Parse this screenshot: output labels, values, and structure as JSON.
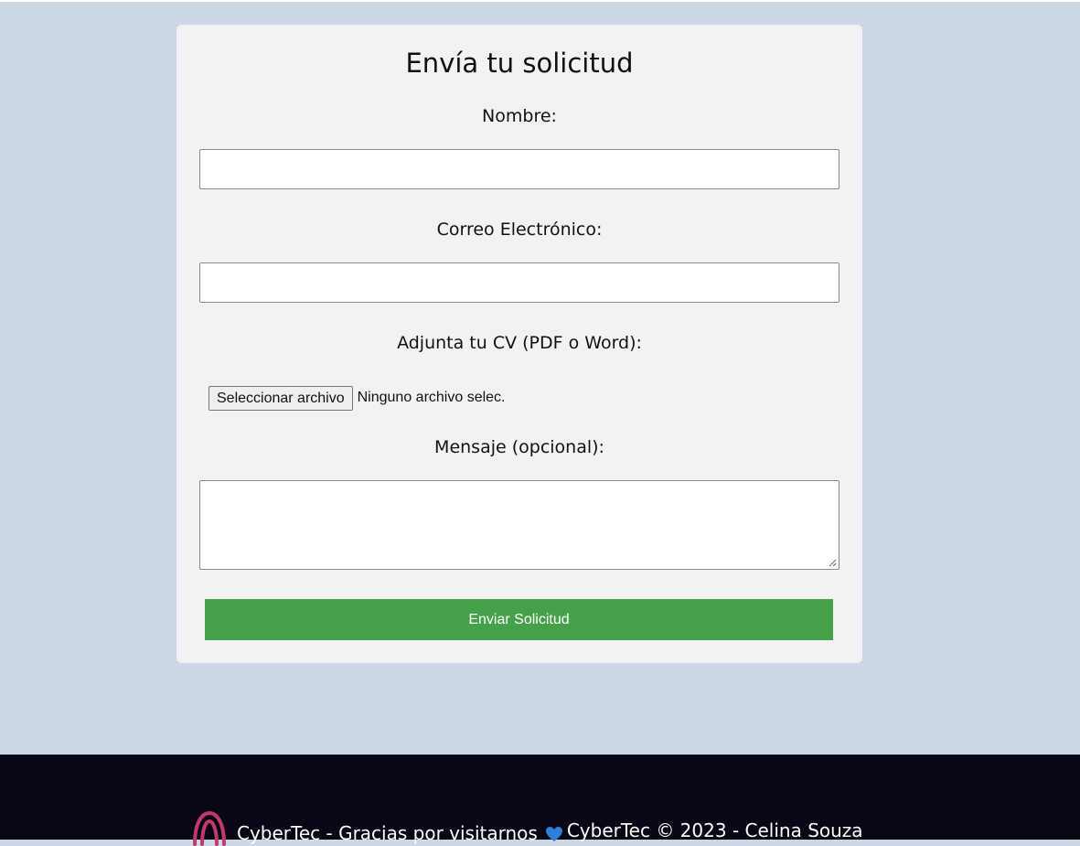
{
  "form": {
    "title": "Envía tu solicitud",
    "name_label": "Nombre:",
    "name_value": "",
    "email_label": "Correo Electrónico:",
    "email_value": "",
    "cv_label": "Adjunta tu CV (PDF o Word):",
    "file_button_label": "Seleccionar archivo",
    "file_status": "Ninguno archivo selec.",
    "message_label": "Mensaje (opcional):",
    "message_value": "",
    "submit_label": "Enviar Solicitud"
  },
  "footer": {
    "logo_icon": "arch-logo-icon",
    "text_left": "CyberTec - Gracias por visitarnos",
    "heart_icon": "blue-heart-icon",
    "text_right": "CyberTec © 2023 - Celina Souza"
  },
  "colors": {
    "page_background": "#ccd7e7",
    "card_background": "#f2f2f2",
    "submit_button": "#45a149",
    "footer_background": "#080814",
    "logo": "#c23a6b",
    "heart": "#2f7fd6"
  }
}
